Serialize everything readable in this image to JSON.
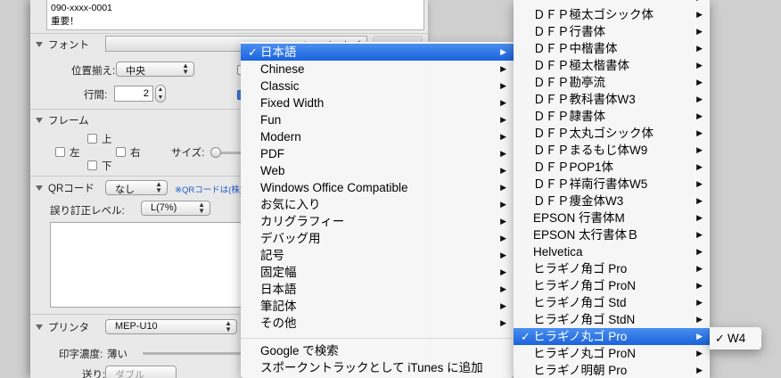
{
  "text_area": {
    "lines": [
      "090-xxxx-0001",
      "重要！"
    ]
  },
  "font_section": {
    "title": "フォント",
    "font_value": "ヒラギノ丸ゴ",
    "alignment_label": "位置揃え:",
    "alignment_value": "中央",
    "line_spacing_label": "行間:",
    "line_spacing_value": "2"
  },
  "frame_section": {
    "title": "フレーム",
    "top": "上",
    "left": "左",
    "right": "右",
    "bottom": "下",
    "size_label": "サイズ:"
  },
  "qr_section": {
    "title": "QRコード",
    "value": "なし",
    "note": "※QRコードは(株)デ",
    "error_level_label": "誤り訂正レベル:",
    "error_level_value": "L(7%)"
  },
  "printer_section": {
    "title": "プリンタ",
    "printer_value": "MEP-U10",
    "density_label": "印字濃度:",
    "density_value": "薄い",
    "feed_label": "送り:",
    "feed_value": "ダブル"
  },
  "menu_categories": {
    "items": [
      {
        "label": "日本語",
        "checked": "✓",
        "submenu": "▶"
      },
      {
        "label": "Chinese",
        "submenu": "▶"
      },
      {
        "label": "Classic",
        "submenu": "▶"
      },
      {
        "label": "Fixed Width",
        "submenu": "▶"
      },
      {
        "label": "Fun",
        "submenu": "▶"
      },
      {
        "label": "Modern",
        "submenu": "▶"
      },
      {
        "label": "PDF",
        "submenu": "▶"
      },
      {
        "label": "Web",
        "submenu": "▶"
      },
      {
        "label": "Windows Office Compatible",
        "submenu": "▶"
      },
      {
        "label": "お気に入り",
        "submenu": "▶"
      },
      {
        "label": "カリグラフィー",
        "submenu": "▶"
      },
      {
        "label": "デバッグ用",
        "submenu": "▶"
      },
      {
        "label": "記号",
        "submenu": "▶"
      },
      {
        "label": "固定幅",
        "submenu": "▶"
      },
      {
        "label": "日本語",
        "submenu": "▶"
      },
      {
        "label": "筆記体",
        "submenu": "▶"
      },
      {
        "label": "その他",
        "submenu": "▶"
      }
    ],
    "actions": [
      "Google で検索",
      "スポークントラックとして iTunes に追加"
    ]
  },
  "menu_fonts": {
    "items": [
      {
        "label": "ＤＦＰ極太ゴシック体",
        "submenu": "▶"
      },
      {
        "label": "ＤＦＰ行書体",
        "submenu": "▶"
      },
      {
        "label": "ＤＦＰ中楷書体",
        "submenu": "▶"
      },
      {
        "label": "ＤＦＰ極太楷書体",
        "submenu": "▶"
      },
      {
        "label": "ＤＦＰ勘亭流",
        "submenu": "▶"
      },
      {
        "label": "ＤＦＰ教科書体W3",
        "submenu": "▶"
      },
      {
        "label": "ＤＦＰ隷書体",
        "submenu": "▶"
      },
      {
        "label": "ＤＦＰ太丸ゴシック体",
        "submenu": "▶"
      },
      {
        "label": "ＤＦＰまるもじ体W9",
        "submenu": "▶"
      },
      {
        "label": "ＤＦＰPOP1体",
        "submenu": "▶"
      },
      {
        "label": "ＤＦＰ祥南行書体W5",
        "submenu": "▶"
      },
      {
        "label": "ＤＦＰ痩金体W3",
        "submenu": "▶"
      },
      {
        "label": "EPSON 行書体M",
        "submenu": "▶"
      },
      {
        "label": "EPSON 太行書体Ｂ",
        "submenu": "▶"
      },
      {
        "label": "Helvetica",
        "submenu": "▶"
      },
      {
        "label": "ヒラギノ角ゴ Pro",
        "submenu": "▶"
      },
      {
        "label": "ヒラギノ角ゴ ProN",
        "submenu": "▶"
      },
      {
        "label": "ヒラギノ角ゴ Std",
        "submenu": "▶"
      },
      {
        "label": "ヒラギノ角ゴ StdN",
        "submenu": "▶"
      },
      {
        "label": "ヒラギノ丸ゴ Pro",
        "checked": "✓",
        "submenu": "▶"
      },
      {
        "label": "ヒラギノ丸ゴ ProN",
        "submenu": "▶"
      },
      {
        "label": "ヒラギノ明朝 Pro",
        "submenu": "▶"
      }
    ]
  },
  "menu_weights": {
    "items": [
      {
        "label": "W4",
        "checked": "✓"
      }
    ]
  },
  "colors": {
    "menu_highlight": "#2a6fe6",
    "link": "#1e5bc6"
  }
}
